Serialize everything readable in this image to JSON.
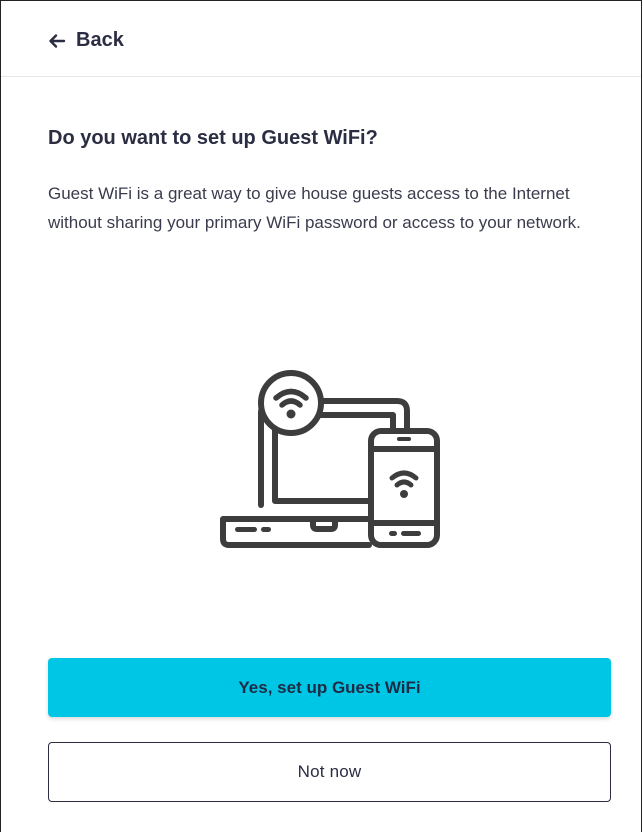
{
  "header": {
    "back_label": "Back",
    "back_icon": "arrow-left-icon"
  },
  "content": {
    "title": "Do you want to set up Guest WiFi?",
    "description": "Guest WiFi is a great way to give house guests access to the Internet without sharing your primary WiFi password or access to your network.",
    "illustration_icon": "laptop-phone-wifi-icon"
  },
  "actions": {
    "primary_label": "Yes, set up Guest WiFi",
    "secondary_label": "Not now"
  },
  "colors": {
    "primary_button": "#00c6e6",
    "text": "#2b2d42",
    "illustration_stroke": "#3d3d3d"
  }
}
